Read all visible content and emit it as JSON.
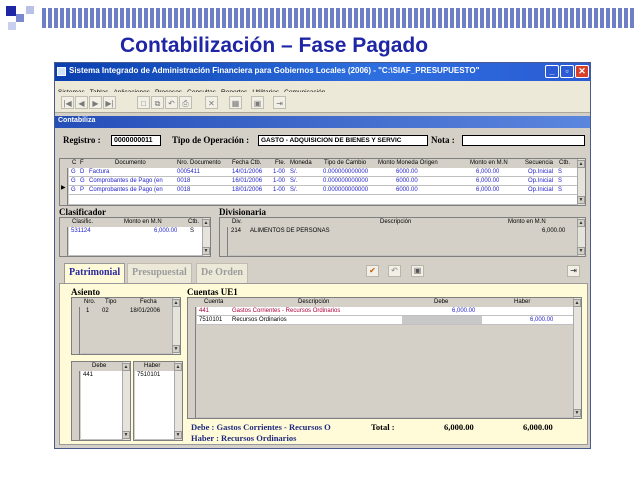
{
  "slide": {
    "title": "Contabilización – Fase Pagado"
  },
  "window": {
    "title": "Sistema Integrado de Administración Financiera para Gobiernos Locales (2006) - \"C:\\SIAF_PRESUPUESTO\"",
    "menu": [
      "Sistemas",
      "Tablas",
      "Aplicaciones",
      "Procesos",
      "Consultas",
      "Reportes",
      "Utilitarios",
      "Comunicación"
    ],
    "section": "Contabiliza"
  },
  "form": {
    "registro_label": "Registro :",
    "registro_value": "0000000011",
    "tipo_label": "Tipo de Operación :",
    "tipo_value": "GASTO - ADQUISICION DE BIENES Y SERVIC",
    "nota_label": "Nota :",
    "nota_value": ""
  },
  "documents": {
    "headers": [
      "C",
      "F",
      "Documento",
      "Nro. Documento",
      "Fecha Ctb.",
      "Fte.",
      "Moneda",
      "Tipo de Cambio",
      "Monto Moneda Origen",
      "Monto en M.N",
      "Secuencia",
      "Ctb."
    ],
    "rows": [
      [
        "G",
        "D",
        "Factura",
        "0005411",
        "14/01/2006",
        "1-00",
        "S/.",
        "0.000000000000",
        "6000.00",
        "6,000.00",
        "Op.Inicial",
        "S"
      ],
      [
        "G",
        "G",
        "Comprobantes de Pago (en",
        "0018",
        "16/01/2006",
        "1-00",
        "S/.",
        "0.000000000000",
        "6000.00",
        "6,000.00",
        "Op.Inicial",
        "S"
      ],
      [
        "G",
        "P",
        "Comprobantes de Pago (en",
        "0018",
        "18/01/2006",
        "1-00",
        "S/.",
        "0.000000000000",
        "6000.00",
        "6,000.00",
        "Op.Inicial",
        "S"
      ]
    ]
  },
  "clasificador": {
    "label": "Clasificador",
    "headers": [
      "Clasific.",
      "Monto en M.N",
      "Ctb."
    ],
    "rows": [
      [
        "531124",
        "6,000.00",
        "S"
      ]
    ]
  },
  "divisionaria": {
    "label": "Divisionaria",
    "headers": [
      "Div.",
      "Descripción",
      "Monto en M.N"
    ],
    "rows": [
      [
        "214",
        "ALIMENTOS DE PERSONAS",
        "6,000.00"
      ]
    ]
  },
  "tabs": [
    "Patrimonial",
    "Presupuestal",
    "De Orden"
  ],
  "asiento": {
    "label": "Asiento",
    "headers": [
      "Nro.",
      "Tipo",
      "Fecha"
    ],
    "rows": [
      [
        "1",
        "02",
        "18/01/2006"
      ]
    ]
  },
  "debe_haber": {
    "debe_header": "Debe",
    "haber_header": "Haber",
    "debe_rows": [
      "441"
    ],
    "haber_rows": [
      "7510101"
    ]
  },
  "cuentas": {
    "label": "Cuentas UE1",
    "headers": [
      "Cuenta",
      "Descripción",
      "Debe",
      "Haber"
    ],
    "rows": [
      [
        "441",
        "Gastos Corrientes - Recursos Ordinarios",
        "6,000.00",
        ""
      ],
      [
        "7510101",
        "Recursos Ordinarios",
        "",
        "6,000.00"
      ]
    ]
  },
  "footer": {
    "debe_line": "Debe : Gastos Corrientes - Recursos O",
    "haber_line": "Haber : Recursos Ordinarios",
    "total_label": "Total :",
    "total_debe": "6,000.00",
    "total_haber": "6,000.00"
  },
  "colors": {
    "slide_title": "#1f26a6",
    "titlebar": "#0a3fae",
    "tab_panel": "#fffbd8",
    "link_text": "#2222cc"
  }
}
